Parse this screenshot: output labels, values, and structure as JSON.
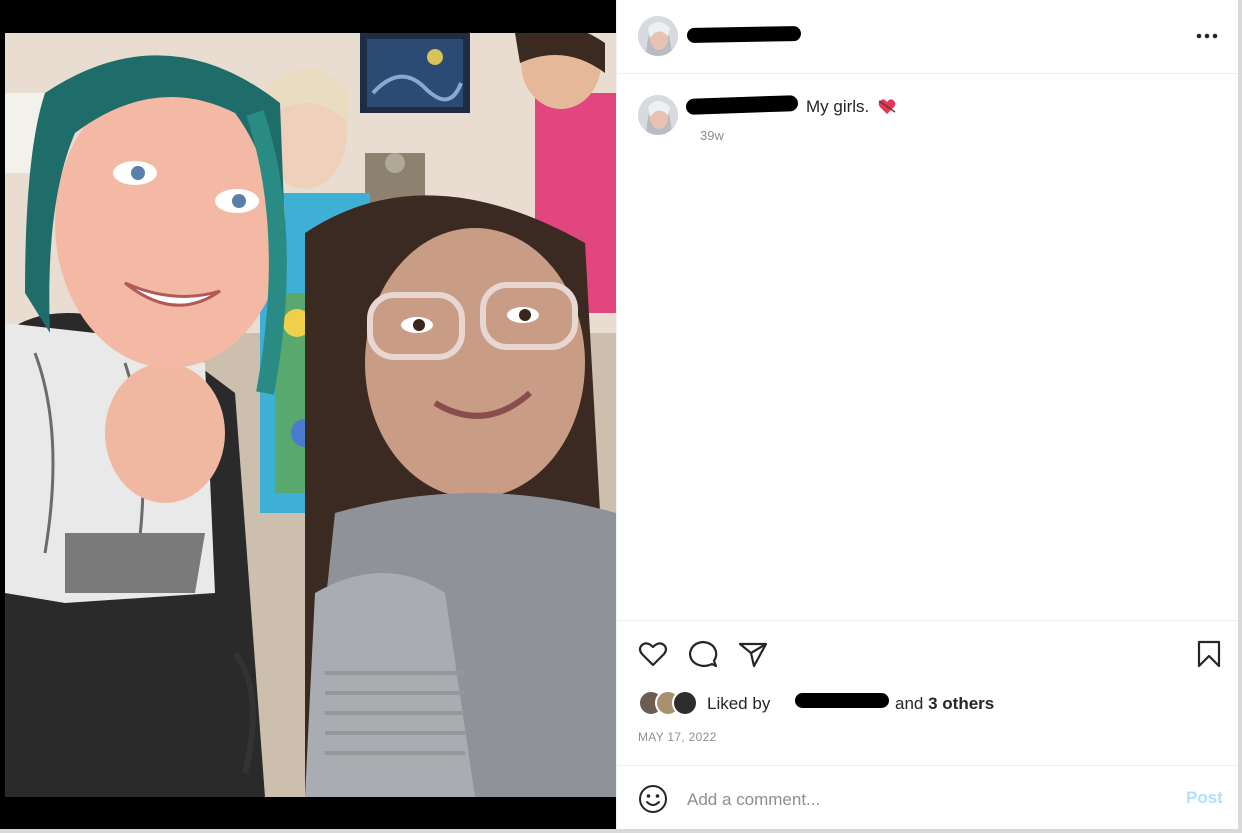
{
  "post": {
    "image_alt": "Selfie photo",
    "username_redacted": true,
    "caption": {
      "text": "My girls.",
      "emoji": "heart-with-arrow",
      "age": "39w"
    },
    "likes": {
      "prefix": "Liked by",
      "conjunction": "and",
      "others": "3 others"
    },
    "date": "MAY 17, 2022"
  },
  "comment_box": {
    "placeholder": "Add a comment...",
    "post_label": "Post"
  },
  "colors": {
    "post_button_disabled": "#b2dffc",
    "secondary_text": "#8e8e8e",
    "divider": "#efefef",
    "heart_emoji": "#e8365a"
  },
  "icons": {
    "more": "more-horizontal-icon",
    "like": "heart-outline-icon",
    "comment": "speech-bubble-icon",
    "share": "paper-plane-icon",
    "save": "bookmark-outline-icon",
    "emoji": "smiley-face-icon"
  }
}
